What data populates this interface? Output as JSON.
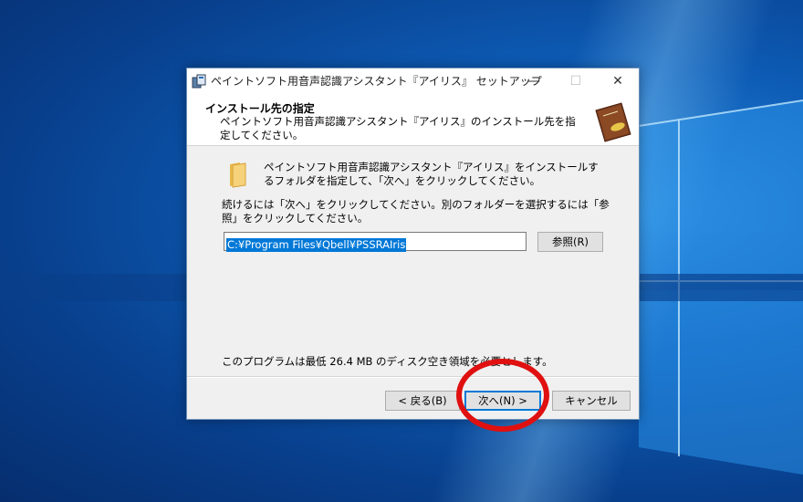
{
  "window": {
    "title": "ペイントソフト用音声認識アシスタント『アイリス』 セットアップ",
    "controls": {
      "minimize": "—",
      "maximize": "☐",
      "close": "✕"
    }
  },
  "header": {
    "title": "インストール先の指定",
    "subtitle": "ペイントソフト用音声認識アシスタント『アイリス』のインストール先を指定してください。"
  },
  "body": {
    "intro": "ペイントソフト用音声認識アシスタント『アイリス』をインストールするフォルダを指定して、「次へ」をクリックしてください。",
    "instruction": "続けるには「次へ」をクリックしてください。別のフォルダーを選択するには「参照」をクリックしてください。",
    "install_path": "C:¥Program Files¥Qbell¥PSSRAIris",
    "browse_label": "参照(R)",
    "disk_requirement": "このプログラムは最低 26.4 MB のディスク空き領域を必要とします。"
  },
  "footer": {
    "back_label": "< 戻る(B)",
    "next_label": "次へ(N) >",
    "cancel_label": "キャンセル"
  },
  "colors": {
    "highlight": "#e01010",
    "selection": "#0078d7",
    "desktop": "#0d5cb6"
  },
  "icons": [
    "setup-app-icon",
    "folder-icon",
    "wizard-book-image",
    "windows-logo"
  ]
}
